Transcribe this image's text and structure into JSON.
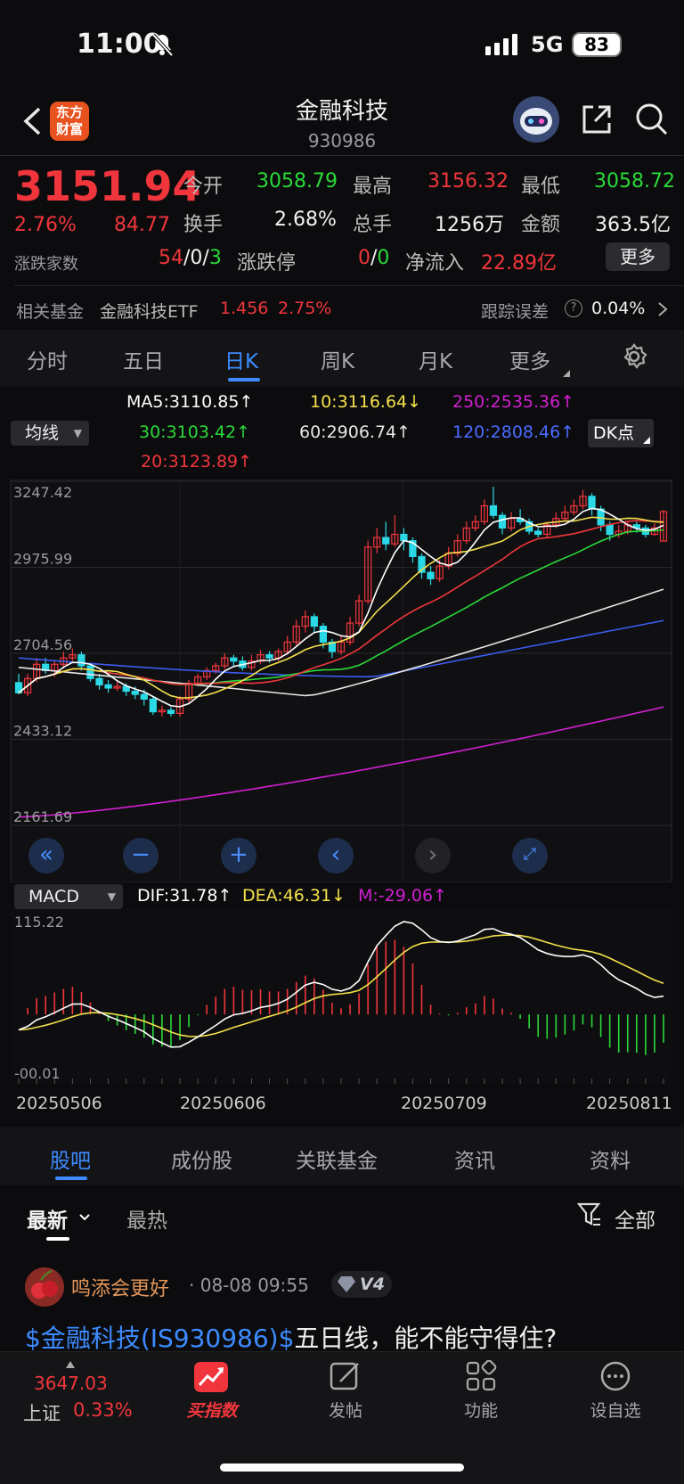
{
  "status_bar": {
    "time": "11:00",
    "network": "5G",
    "battery": "83"
  },
  "header": {
    "brand_line1": "东方",
    "brand_line2": "财富",
    "title": "金融科技",
    "code": "930986"
  },
  "quote": {
    "price": "3151.94",
    "change_pct": "2.76%",
    "change": "84.77",
    "open_label": "今开",
    "open": "3058.79",
    "high_label": "最高",
    "high": "3156.32",
    "low_label": "最低",
    "low": "3058.72",
    "turnover_label": "换手",
    "turnover": "2.68%",
    "volume_label": "总手",
    "volume": "1256万",
    "amount_label": "金额",
    "amount": "363.5亿",
    "breadth_label": "涨跌家数",
    "breadth_up": "54",
    "breadth_flat": "0",
    "breadth_down": "3",
    "limit_label": "涨跌停",
    "limit_up": "0",
    "limit_down": "0",
    "netflow_label": "净流入",
    "netflow": "22.89亿",
    "more_button": "更多"
  },
  "fund": {
    "label": "相关基金",
    "name": "金融科技ETF",
    "price": "1.456",
    "pct": "2.75%",
    "track_label": "跟踪误差",
    "track_value": "0.04%"
  },
  "period_tabs": [
    {
      "label": "分时"
    },
    {
      "label": "五日"
    },
    {
      "label": "日K"
    },
    {
      "label": "周K"
    },
    {
      "label": "月K"
    },
    {
      "label": "更多"
    }
  ],
  "ma_legend": {
    "selector": "均线",
    "dk_button": "DK点",
    "ma5": "MA5:3110.85↑",
    "ma10": "10:3116.64↓",
    "ma250": "250:2535.36↑",
    "ma30": "30:3103.42↑",
    "ma60": "60:2906.74↑",
    "ma120": "120:2808.46↑",
    "ma20": "20:3123.89↑"
  },
  "macd_legend": {
    "selector": "MACD",
    "dif": "DIF:31.78↑",
    "dea": "DEA:46.31↓",
    "m": "M:-29.06↑"
  },
  "colors": {
    "up": "#f0363c",
    "down": "#2bd9e6",
    "ma5": "#ffffff",
    "ma10": "#f4e04b",
    "ma20": "#f0363c",
    "ma30": "#2bd93a",
    "ma60": "#e6e6e6",
    "ma120": "#3c5cf0",
    "ma250": "#d21fd2",
    "accent": "#3d8bff"
  },
  "chart_data": [
    {
      "type": "candlestick",
      "title": "",
      "y_ticks": [
        "3247.42",
        "2975.99",
        "2704.56",
        "2433.12",
        "2161.69"
      ],
      "ylim": [
        2161.69,
        3247.42
      ],
      "x_ticks": [
        "20250506",
        "20250606",
        "20250709",
        "20250811"
      ],
      "candles": [
        [
          2612,
          2580,
          2640,
          2575
        ],
        [
          2580,
          2625,
          2640,
          2570
        ],
        [
          2625,
          2670,
          2690,
          2615
        ],
        [
          2670,
          2650,
          2690,
          2640
        ],
        [
          2650,
          2670,
          2680,
          2630
        ],
        [
          2670,
          2690,
          2710,
          2655
        ],
        [
          2690,
          2700,
          2720,
          2680
        ],
        [
          2700,
          2665,
          2710,
          2650
        ],
        [
          2665,
          2625,
          2670,
          2615
        ],
        [
          2625,
          2605,
          2640,
          2590
        ],
        [
          2605,
          2595,
          2620,
          2580
        ],
        [
          2595,
          2600,
          2615,
          2585
        ],
        [
          2600,
          2585,
          2610,
          2570
        ],
        [
          2585,
          2575,
          2600,
          2560
        ],
        [
          2575,
          2560,
          2590,
          2540
        ],
        [
          2560,
          2520,
          2570,
          2510
        ],
        [
          2520,
          2525,
          2540,
          2505
        ],
        [
          2525,
          2515,
          2535,
          2505
        ],
        [
          2515,
          2560,
          2570,
          2505
        ],
        [
          2560,
          2610,
          2620,
          2550
        ],
        [
          2610,
          2630,
          2640,
          2600
        ],
        [
          2630,
          2650,
          2660,
          2620
        ],
        [
          2650,
          2665,
          2675,
          2640
        ],
        [
          2665,
          2690,
          2705,
          2655
        ],
        [
          2690,
          2680,
          2700,
          2665
        ],
        [
          2680,
          2660,
          2695,
          2650
        ],
        [
          2660,
          2680,
          2700,
          2650
        ],
        [
          2680,
          2700,
          2715,
          2670
        ],
        [
          2700,
          2690,
          2712,
          2675
        ],
        [
          2690,
          2710,
          2720,
          2680
        ],
        [
          2710,
          2740,
          2760,
          2700
        ],
        [
          2740,
          2790,
          2810,
          2730
        ],
        [
          2790,
          2820,
          2840,
          2770
        ],
        [
          2820,
          2790,
          2830,
          2770
        ],
        [
          2790,
          2740,
          2800,
          2720
        ],
        [
          2740,
          2710,
          2750,
          2690
        ],
        [
          2710,
          2740,
          2760,
          2700
        ],
        [
          2740,
          2800,
          2820,
          2730
        ],
        [
          2800,
          2870,
          2890,
          2790
        ],
        [
          2870,
          3040,
          3060,
          2860
        ],
        [
          3040,
          3070,
          3100,
          3020
        ],
        [
          3070,
          3050,
          3120,
          3030
        ],
        [
          3050,
          3080,
          3140,
          3040
        ],
        [
          3080,
          3060,
          3100,
          3030
        ],
        [
          3060,
          3010,
          3070,
          2990
        ],
        [
          3010,
          2960,
          3020,
          2940
        ],
        [
          2960,
          2940,
          2980,
          2920
        ],
        [
          2940,
          2980,
          3000,
          2930
        ],
        [
          2980,
          3020,
          3040,
          2970
        ],
        [
          3020,
          3060,
          3080,
          3010
        ],
        [
          3060,
          3100,
          3120,
          3050
        ],
        [
          3100,
          3120,
          3140,
          3090
        ],
        [
          3120,
          3170,
          3190,
          3110
        ],
        [
          3170,
          3140,
          3230,
          3130
        ],
        [
          3140,
          3100,
          3150,
          3080
        ],
        [
          3100,
          3130,
          3150,
          3090
        ],
        [
          3130,
          3120,
          3160,
          3110
        ],
        [
          3120,
          3090,
          3130,
          3080
        ],
        [
          3090,
          3080,
          3100,
          3070
        ],
        [
          3080,
          3110,
          3120,
          3070
        ],
        [
          3110,
          3130,
          3150,
          3100
        ],
        [
          3130,
          3150,
          3170,
          3120
        ],
        [
          3150,
          3170,
          3190,
          3140
        ],
        [
          3170,
          3200,
          3220,
          3160
        ],
        [
          3200,
          3160,
          3210,
          3140
        ],
        [
          3160,
          3110,
          3170,
          3090
        ],
        [
          3110,
          3080,
          3120,
          3060
        ],
        [
          3080,
          3090,
          3110,
          3070
        ],
        [
          3090,
          3110,
          3120,
          3080
        ],
        [
          3110,
          3100,
          3120,
          3085
        ],
        [
          3100,
          3080,
          3110,
          3070
        ],
        [
          3080,
          3100,
          3115,
          3075
        ],
        [
          3058.79,
          3151.94,
          3156.32,
          3058.72
        ]
      ]
    },
    {
      "type": "macd",
      "title": "",
      "y_ticks": [
        "115.22",
        "-00.01"
      ],
      "ylim": [
        -10,
        115.22
      ]
    }
  ],
  "content_tabs": [
    {
      "label": "股吧"
    },
    {
      "label": "成份股"
    },
    {
      "label": "关联基金"
    },
    {
      "label": "资讯"
    },
    {
      "label": "资料"
    }
  ],
  "feed": {
    "sort_latest": "最新",
    "sort_hot": "最热",
    "filter": "全部"
  },
  "post": {
    "user": "鸣添会更好",
    "time": "· 08-08 09:55",
    "level": "V4",
    "link": "$金融科技(IS930986)$",
    "text": "五日线，能不能守得住?"
  },
  "bottom_nav": {
    "index_value": "3647.03",
    "index_name": "上证",
    "index_pct": "0.33%",
    "buy": "买指数",
    "post": "发帖",
    "func": "功能",
    "watch": "设自选"
  }
}
